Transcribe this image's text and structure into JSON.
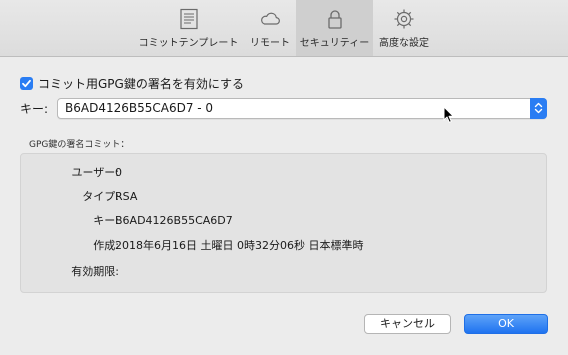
{
  "toolbar": {
    "tabs": [
      {
        "label": "コミットテンプレート",
        "icon": "document-icon",
        "selected": false
      },
      {
        "label": "リモート",
        "icon": "cloud-icon",
        "selected": false
      },
      {
        "label": "セキュリティー",
        "icon": "lock-icon",
        "selected": true
      },
      {
        "label": "高度な設定",
        "icon": "gear-icon",
        "selected": false
      }
    ]
  },
  "signing": {
    "checkbox_label": "コミット用GPG鍵の署名を有効にする",
    "checked": true
  },
  "key": {
    "label": "キー:",
    "selected_value": "B6AD4126B55CA6D7 - 0"
  },
  "group": {
    "title": "GPG鍵の署名コミット：",
    "rows": [
      {
        "label": "ユーザー:",
        "value": "0"
      },
      {
        "label": "タイプ:",
        "value": "RSA"
      },
      {
        "label": "キー:",
        "value": "B6AD4126B55CA6D7"
      },
      {
        "label": "作成:",
        "value": "2018年6月16日 土曜日 0時32分06秒 日本標準時"
      },
      {
        "label": "有効期限:",
        "value": ""
      }
    ]
  },
  "buttons": {
    "cancel_label": "キャンセル",
    "ok_label": "OK"
  },
  "colors": {
    "accent": "#2a7df3",
    "window_bg": "#ececec",
    "selected_tab_bg": "#cfcfcf"
  }
}
